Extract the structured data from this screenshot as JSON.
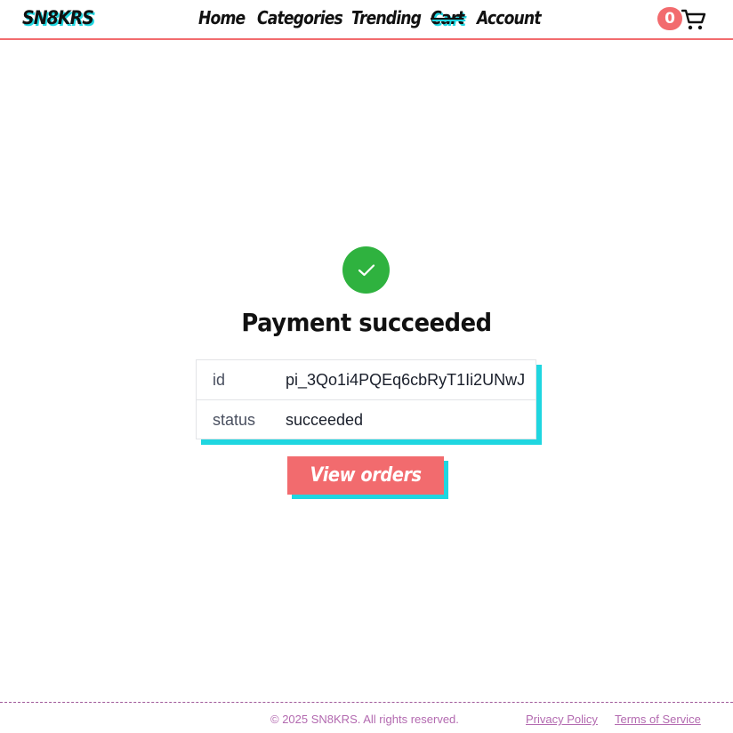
{
  "header": {
    "brand": "SN8KRS",
    "nav": {
      "home": "Home",
      "categories": "Categories",
      "trending": "Trending",
      "cart": "Cart",
      "account": "Account"
    },
    "cart_count": "0"
  },
  "main": {
    "title": "Payment succeeded",
    "details": [
      {
        "key": "id",
        "value": "pi_3Qo1i4PQEq6cbRyT1Ii2UNwJ"
      },
      {
        "key": "status",
        "value": "succeeded"
      }
    ],
    "button_label": "View orders"
  },
  "footer": {
    "copyright": "© 2025 SN8KRS. All rights reserved.",
    "privacy": "Privacy Policy",
    "terms": "Terms of Service"
  },
  "colors": {
    "accent": "#f26b6e",
    "shadow": "#1fd6e0",
    "success": "#2fb23f",
    "footer_text": "#b36ab0"
  },
  "icons": {
    "cart": "cart-icon",
    "check": "check-icon"
  }
}
